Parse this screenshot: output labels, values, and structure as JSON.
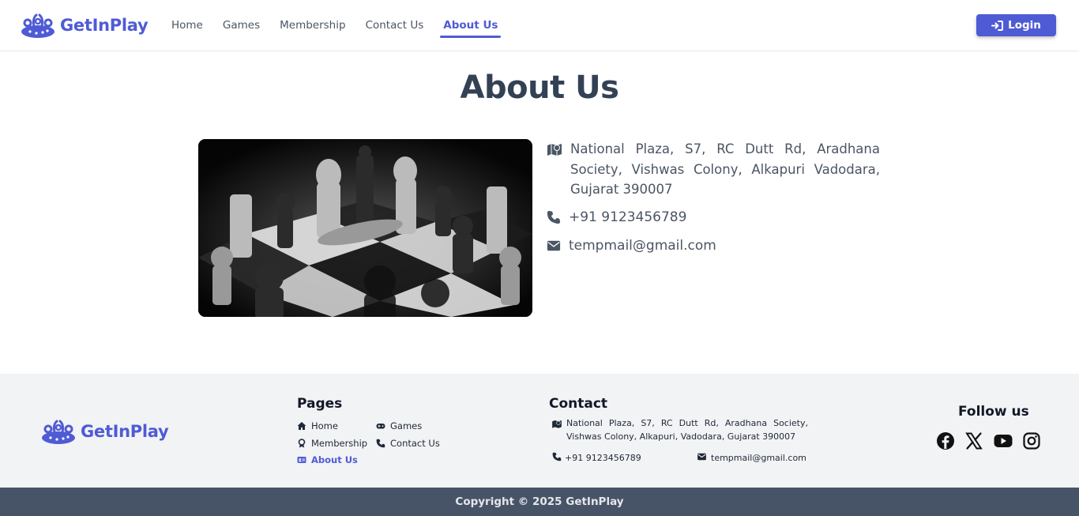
{
  "brand": {
    "name": "GetInPlay",
    "color": "#4f5bd5",
    "icon": "brand-logo-icon"
  },
  "nav": {
    "items": [
      {
        "label": "Home"
      },
      {
        "label": "Games"
      },
      {
        "label": "Membership"
      },
      {
        "label": "Contact Us"
      },
      {
        "label": "About Us",
        "active": true
      }
    ],
    "login_label": "Login",
    "login_icon": "sign-in-icon"
  },
  "page": {
    "title": "About Us"
  },
  "about": {
    "image_alt": "chess-board-photo",
    "address": "National Plaza, S7, RC Dutt Rd, Aradhana Society, Vishwas Colony, Alkapuri Vadodara, Gujarat 390007",
    "phone": "+91 9123456789",
    "email": "tempmail@gmail.com"
  },
  "footer": {
    "brand_name": "GetInPlay",
    "pages_heading": "Pages",
    "pages": {
      "home": "Home",
      "games": "Games",
      "membership": "Membership",
      "contact": "Contact Us",
      "about": "About Us"
    },
    "contact_heading": "Contact",
    "contact_address": "National Plaza, S7, RC Dutt Rd, Aradhana Society, Vishwas Colony, Alkapuri, Vadodara, Gujarat 390007",
    "contact_phone": "+91 9123456789",
    "contact_email": "tempmail@gmail.com",
    "follow_heading": "Follow us",
    "social_icons": [
      "facebook-icon",
      "x-twitter-icon",
      "youtube-icon",
      "instagram-icon"
    ]
  },
  "copyright": "Copyright © 2025 GetInPlay",
  "colors": {
    "accent": "#4f5bd5",
    "text_dark": "#334155",
    "footer_bg": "#f2f3f5",
    "copyright_bg": "#475467"
  }
}
